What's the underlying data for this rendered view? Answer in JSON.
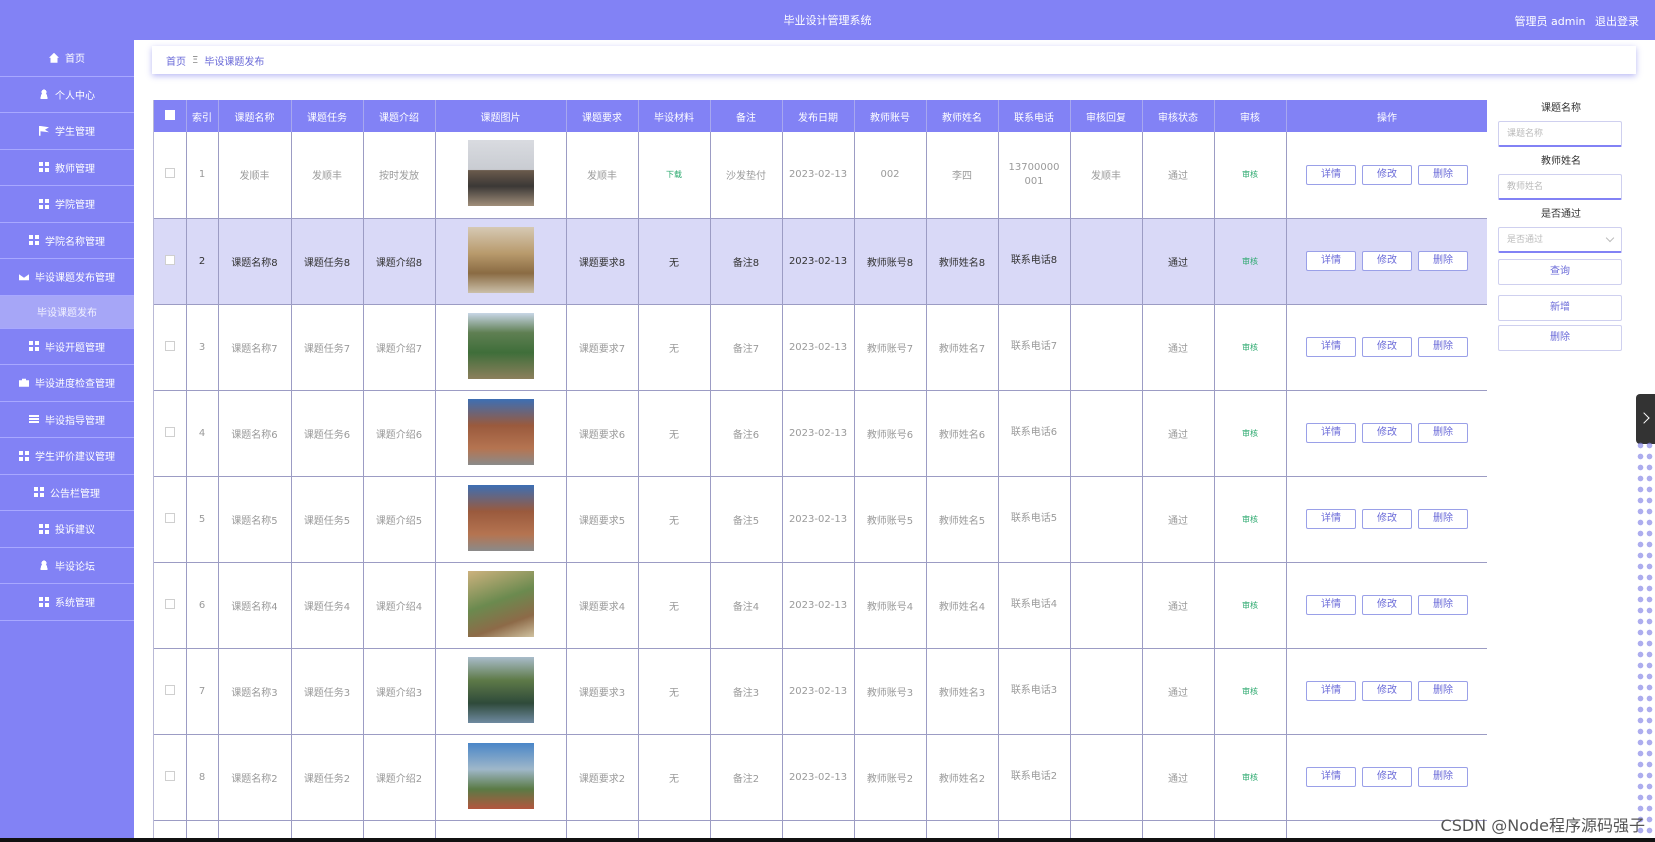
{
  "header": {
    "title": "毕业设计管理系统",
    "user": "管理员 admin",
    "logout": "退出登录"
  },
  "sidebar": {
    "items": [
      {
        "label": "首页",
        "icon": "home-icon"
      },
      {
        "label": "个人中心",
        "icon": "user-icon"
      },
      {
        "label": "学生管理",
        "icon": "flag-icon"
      },
      {
        "label": "教师管理",
        "icon": "grid-icon"
      },
      {
        "label": "学院管理",
        "icon": "grid-icon"
      },
      {
        "label": "学院名称管理",
        "icon": "grid-icon"
      },
      {
        "label": "毕设课题发布管理",
        "icon": "mail-icon"
      },
      {
        "label": "毕设课题发布",
        "icon": "",
        "sub": true
      },
      {
        "label": "毕设开题管理",
        "icon": "grid-icon"
      },
      {
        "label": "毕设进度检查管理",
        "icon": "briefcase-icon"
      },
      {
        "label": "毕设指导管理",
        "icon": "list-icon"
      },
      {
        "label": "学生评价建议管理",
        "icon": "grid-icon"
      },
      {
        "label": "公告栏管理",
        "icon": "grid-icon"
      },
      {
        "label": "投诉建议",
        "icon": "grid-icon"
      },
      {
        "label": "毕设论坛",
        "icon": "user-icon"
      },
      {
        "label": "系统管理",
        "icon": "grid-icon"
      }
    ]
  },
  "breadcrumb": {
    "home": "首页",
    "sep": "Ξ",
    "current": "毕设课题发布"
  },
  "table": {
    "headers": [
      "索引",
      "课题名称",
      "课题任务",
      "课题介绍",
      "课题图片",
      "课题要求",
      "毕设材料",
      "备注",
      "发布日期",
      "教师账号",
      "教师姓名",
      "联系电话",
      "审核回复",
      "审核状态",
      "审核",
      "操作"
    ],
    "rows": [
      {
        "idx": "1",
        "name": "发顺丰",
        "task": "发顺丰",
        "intro": "按时发放",
        "req": "发顺丰",
        "material": "下载",
        "note": "沙发垫付",
        "date": "2023-02-13",
        "account": "002",
        "teacher": "李四",
        "phone": "13700000001",
        "reply": "发顺丰",
        "status": "通过",
        "audit": "审核"
      },
      {
        "idx": "2",
        "name": "课题名称8",
        "task": "课题任务8",
        "intro": "课题介绍8",
        "req": "课题要求8",
        "material": "无",
        "note": "备注8",
        "date": "2023-02-13",
        "account": "教师账号8",
        "teacher": "教师姓名8",
        "phone": "联系电话8",
        "reply": "",
        "status": "通过",
        "audit": "审核"
      },
      {
        "idx": "3",
        "name": "课题名称7",
        "task": "课题任务7",
        "intro": "课题介绍7",
        "req": "课题要求7",
        "material": "无",
        "note": "备注7",
        "date": "2023-02-13",
        "account": "教师账号7",
        "teacher": "教师姓名7",
        "phone": "联系电话7",
        "reply": "",
        "status": "通过",
        "audit": "审核"
      },
      {
        "idx": "4",
        "name": "课题名称6",
        "task": "课题任务6",
        "intro": "课题介绍6",
        "req": "课题要求6",
        "material": "无",
        "note": "备注6",
        "date": "2023-02-13",
        "account": "教师账号6",
        "teacher": "教师姓名6",
        "phone": "联系电话6",
        "reply": "",
        "status": "通过",
        "audit": "审核"
      },
      {
        "idx": "5",
        "name": "课题名称5",
        "task": "课题任务5",
        "intro": "课题介绍5",
        "req": "课题要求5",
        "material": "无",
        "note": "备注5",
        "date": "2023-02-13",
        "account": "教师账号5",
        "teacher": "教师姓名5",
        "phone": "联系电话5",
        "reply": "",
        "status": "通过",
        "audit": "审核"
      },
      {
        "idx": "6",
        "name": "课题名称4",
        "task": "课题任务4",
        "intro": "课题介绍4",
        "req": "课题要求4",
        "material": "无",
        "note": "备注4",
        "date": "2023-02-13",
        "account": "教师账号4",
        "teacher": "教师姓名4",
        "phone": "联系电话4",
        "reply": "",
        "status": "通过",
        "audit": "审核"
      },
      {
        "idx": "7",
        "name": "课题名称3",
        "task": "课题任务3",
        "intro": "课题介绍3",
        "req": "课题要求3",
        "material": "无",
        "note": "备注3",
        "date": "2023-02-13",
        "account": "教师账号3",
        "teacher": "教师姓名3",
        "phone": "联系电话3",
        "reply": "",
        "status": "通过",
        "audit": "审核"
      },
      {
        "idx": "8",
        "name": "课题名称2",
        "task": "课题任务2",
        "intro": "课题介绍2",
        "req": "课题要求2",
        "material": "无",
        "note": "备注2",
        "date": "2023-02-13",
        "account": "教师账号2",
        "teacher": "教师姓名2",
        "phone": "联系电话2",
        "reply": "",
        "status": "通过",
        "audit": "审核"
      }
    ],
    "actions": {
      "detail": "详情",
      "edit": "修改",
      "delete": "删除"
    }
  },
  "search": {
    "name_label": "课题名称",
    "name_placeholder": "课题名称",
    "teacher_label": "教师姓名",
    "teacher_placeholder": "教师姓名",
    "pass_label": "是否通过",
    "pass_placeholder": "是否通过",
    "query": "查询",
    "add": "新增",
    "delete": "删除"
  },
  "watermark": "CSDN @Node程序源码强子",
  "colors": {
    "accent": "#8282f5",
    "green": "#2aa86d"
  }
}
